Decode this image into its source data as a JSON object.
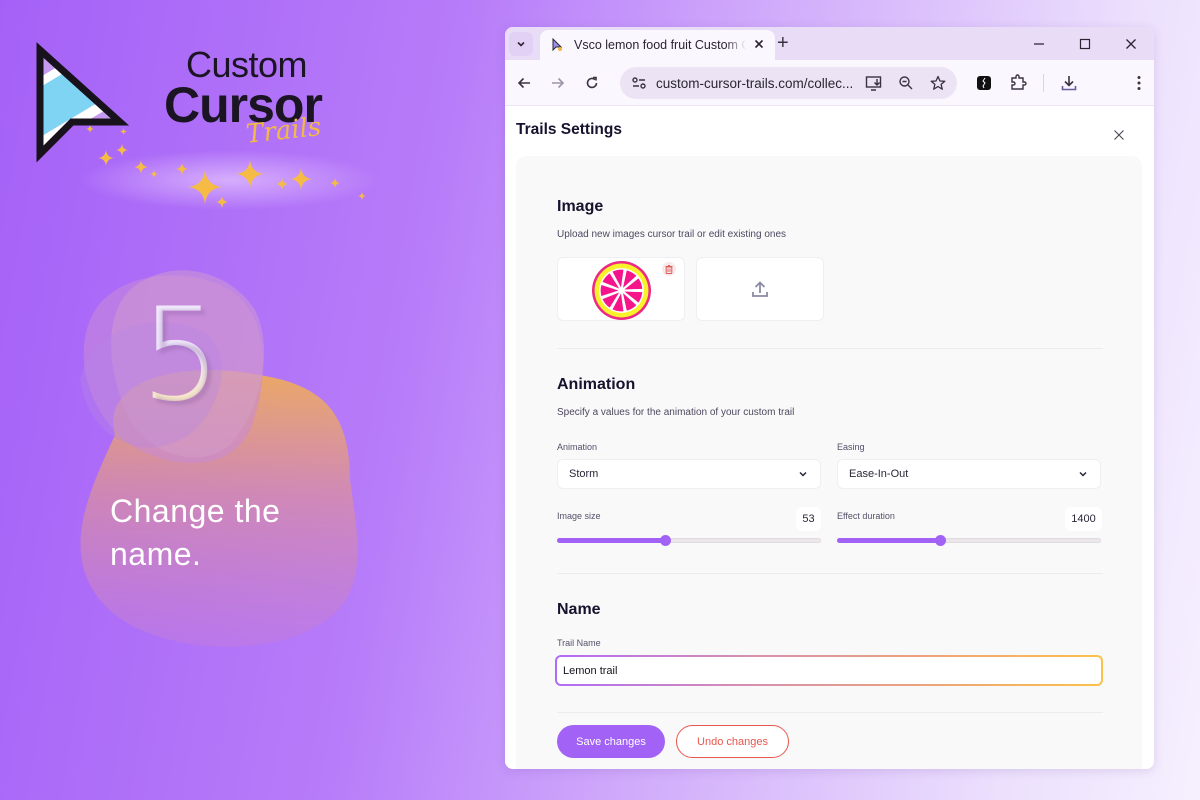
{
  "promo": {
    "logo": {
      "line1": "Custom",
      "line2": "Cursor",
      "line3": "Trails"
    },
    "step_number": "5",
    "step_text": "Change the name."
  },
  "browser": {
    "tab": {
      "title": "Vsco lemon food fruit Custom Cursor Trails",
      "close_icon": "close-icon"
    },
    "new_tab_label": "+",
    "address": {
      "url": "custom-cursor-trails.com/collec..."
    },
    "icons": [
      "back-icon",
      "forward-icon",
      "reload-icon",
      "site-info-icon",
      "install-app-icon",
      "zoom-icon",
      "bookmark-star-icon",
      "extension-app-icon",
      "extensions-puzzle-icon",
      "download-icon",
      "more-menu-icon"
    ]
  },
  "modal": {
    "title": "Trails Settings",
    "image_section": {
      "title": "Image",
      "description": "Upload new images cursor trail or edit existing ones",
      "images": [
        {
          "name": "lemon-slice"
        }
      ]
    },
    "animation_section": {
      "title": "Animation",
      "description": "Specify a values for the animation of your custom trail",
      "animation": {
        "label": "Animation",
        "value": "Storm"
      },
      "easing": {
        "label": "Easing",
        "value": "Ease-In-Out"
      },
      "image_size": {
        "label": "Image size",
        "value": "53",
        "fill_percent": 41
      },
      "effect_duration": {
        "label": "Effect duration",
        "value": "1400",
        "fill_percent": 39
      }
    },
    "name_section": {
      "title": "Name",
      "field_label": "Trail Name",
      "value": "Lemon trail"
    },
    "buttons": {
      "save": "Save changes",
      "undo": "Undo changes"
    }
  },
  "colors": {
    "accent": "#a262f6",
    "danger": "#e8574d",
    "title_text": "#16132e",
    "logo_gold": "#f4b940"
  }
}
